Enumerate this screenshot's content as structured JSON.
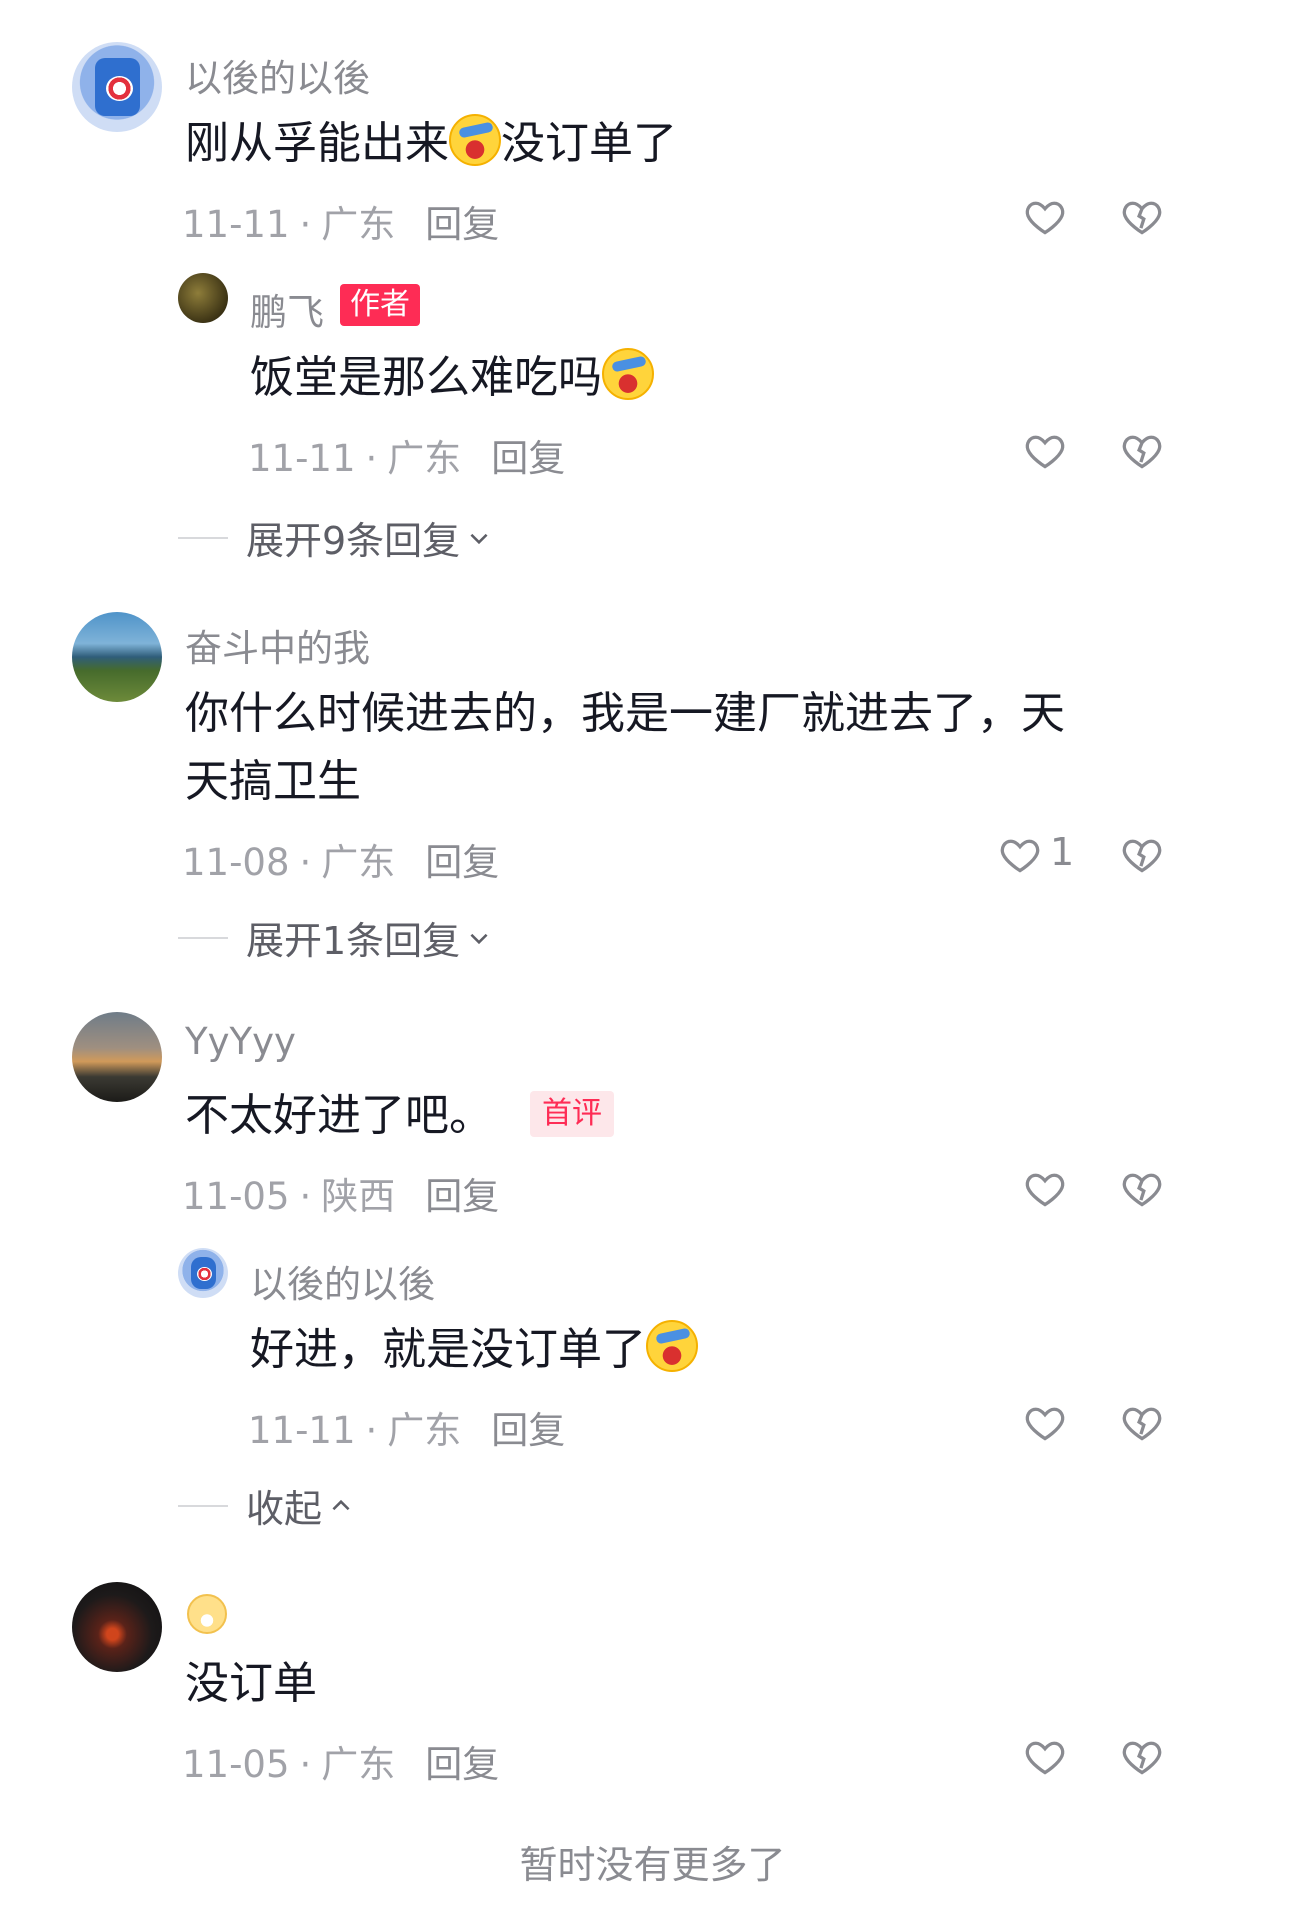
{
  "comments": [
    {
      "user": "以後的以後",
      "text": "刚从孚能出来",
      "text_after_emoji": "没订单了",
      "date": "11-11",
      "region": "广东",
      "reply_label": "回复",
      "replies": [
        {
          "user": "鹏飞",
          "badge": "作者",
          "text": "饭堂是那么难吃吗",
          "date": "11-11",
          "region": "广东",
          "reply_label": "回复"
        }
      ],
      "expand_label": "展开9条回复"
    },
    {
      "user": "奋斗中的我",
      "text_line1": "你什么时候进去的，我是一建厂就进去了，天",
      "text_line2": "天搞卫生",
      "date": "11-08",
      "region": "广东",
      "reply_label": "回复",
      "like_count": "1",
      "expand_label": "展开1条回复"
    },
    {
      "user": "YyYyy",
      "text": "不太好进了吧。",
      "badge": "首评",
      "date": "11-05",
      "region": "陕西",
      "reply_label": "回复",
      "replies": [
        {
          "user": "以後的以後",
          "text": "好进，就是没订单了",
          "date": "11-11",
          "region": "广东",
          "reply_label": "回复"
        }
      ],
      "collapse_label": "收起"
    },
    {
      "user_emoji": "grinning-face",
      "text": "没订单",
      "date": "11-05",
      "region": "广东",
      "reply_label": "回复"
    }
  ],
  "footer": "暂时没有更多了",
  "separator": "·",
  "colors": {
    "accent": "#fe2c55",
    "meta": "#a1a2a8",
    "username": "#8a8b91"
  }
}
